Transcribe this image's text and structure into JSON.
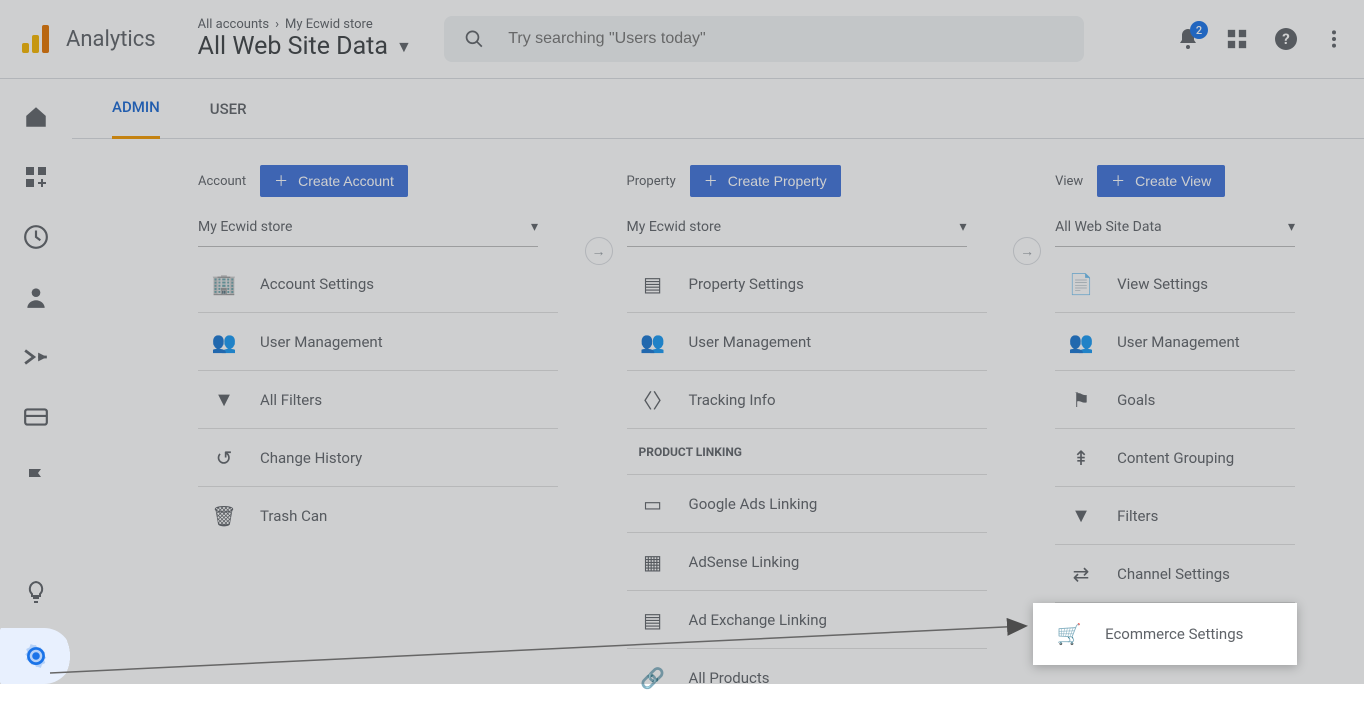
{
  "header": {
    "logo_text": "Analytics",
    "breadcrumb": {
      "lvl1": "All accounts",
      "lvl2": "My Ecwid store"
    },
    "page_title": "All Web Site Data",
    "search_placeholder": "Try searching \"Users today\"",
    "notification_count": "2"
  },
  "tabs": {
    "admin": "ADMIN",
    "user": "USER"
  },
  "selectors": {
    "account": "My Ecwid store",
    "property": "My Ecwid store",
    "view": "All Web Site Data"
  },
  "columns": {
    "account": {
      "label": "Account",
      "create": "Create Account",
      "items": [
        {
          "icon": "building",
          "label": "Account Settings"
        },
        {
          "icon": "people",
          "label": "User Management"
        },
        {
          "icon": "filter",
          "label": "All Filters"
        },
        {
          "icon": "history",
          "label": "Change History"
        },
        {
          "icon": "trash",
          "label": "Trash Can"
        }
      ]
    },
    "property": {
      "label": "Property",
      "create": "Create Property",
      "items": [
        {
          "icon": "panel",
          "label": "Property Settings"
        },
        {
          "icon": "people",
          "label": "User Management"
        },
        {
          "icon": "code",
          "label": "Tracking Info"
        }
      ],
      "section": "PRODUCT LINKING",
      "links": [
        {
          "icon": "card",
          "label": "Google Ads Linking"
        },
        {
          "icon": "grid",
          "label": "AdSense Linking"
        },
        {
          "icon": "panel",
          "label": "Ad Exchange Linking"
        },
        {
          "icon": "link",
          "label": "All Products"
        }
      ]
    },
    "view": {
      "label": "View",
      "create": "Create View",
      "items": [
        {
          "icon": "doc",
          "label": "View Settings"
        },
        {
          "icon": "people",
          "label": "User Management"
        },
        {
          "icon": "flag",
          "label": "Goals"
        },
        {
          "icon": "merge",
          "label": "Content Grouping"
        },
        {
          "icon": "filter",
          "label": "Filters"
        },
        {
          "icon": "channel",
          "label": "Channel Settings"
        },
        {
          "icon": "cart",
          "label": "Ecommerce Settings"
        }
      ]
    }
  }
}
